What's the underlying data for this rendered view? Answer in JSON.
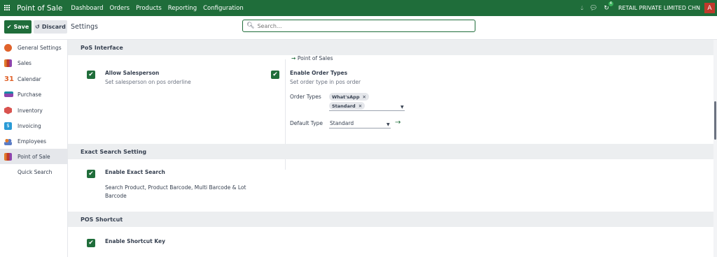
{
  "navbar": {
    "app_name": "Point of Sale",
    "menu": [
      "Dashboard",
      "Orders",
      "Products",
      "Reporting",
      "Configuration"
    ],
    "activity_badge": "4",
    "company": "RETAIL PRIVATE LIMITED CHN",
    "avatar_letter": "A"
  },
  "control": {
    "save_label": "Save",
    "discard_label": "Discard",
    "title": "Settings",
    "search_placeholder": "Search..."
  },
  "sidebar": {
    "items": [
      {
        "label": "General Settings",
        "icon": "general-settings-icon",
        "color": "#e0632b"
      },
      {
        "label": "Sales",
        "icon": "sales-icon",
        "color": "#e07b2b"
      },
      {
        "label": "Calendar",
        "icon": "calendar-icon",
        "color": "#e0632b"
      },
      {
        "label": "Purchase",
        "icon": "purchase-icon",
        "color": "#1a8aa5"
      },
      {
        "label": "Inventory",
        "icon": "inventory-icon",
        "color": "#d9534f"
      },
      {
        "label": "Invoicing",
        "icon": "invoicing-icon",
        "color": "#2a9bd6"
      },
      {
        "label": "Employees",
        "icon": "employees-icon",
        "color": "#5b7cc4"
      },
      {
        "label": "Point of Sale",
        "icon": "point-of-sale-icon",
        "color": "#c0392b"
      }
    ],
    "sub_item": "Quick Search",
    "active_index": 7
  },
  "sections": {
    "pos_interface": {
      "title": "PoS Interface",
      "point_of_sales_link": "Point of Sales",
      "allow_salesperson": {
        "label": "Allow Salesperson",
        "desc": "Set salesperson on pos orderline",
        "checked": true
      },
      "enable_order_types": {
        "label": "Enable Order Types",
        "desc": "Set order type in pos order",
        "checked": true,
        "order_types_label": "Order Types",
        "tags": [
          "What'sApp",
          "Standard"
        ],
        "default_type_label": "Default Type",
        "default_type_value": "Standard"
      }
    },
    "exact_search": {
      "title": "Exact Search Setting",
      "label": "Enable Exact Search",
      "desc_line1": "Search Product, Product Barcode, Multi Barcode & Lot",
      "desc_line2": "Barcode",
      "checked": true
    },
    "pos_shortcut": {
      "title": "POS Shortcut",
      "label": "Enable Shortcut Key",
      "checked": true
    }
  },
  "colors": {
    "brand": "#1f6d3a",
    "section_bg": "#eceef0"
  }
}
